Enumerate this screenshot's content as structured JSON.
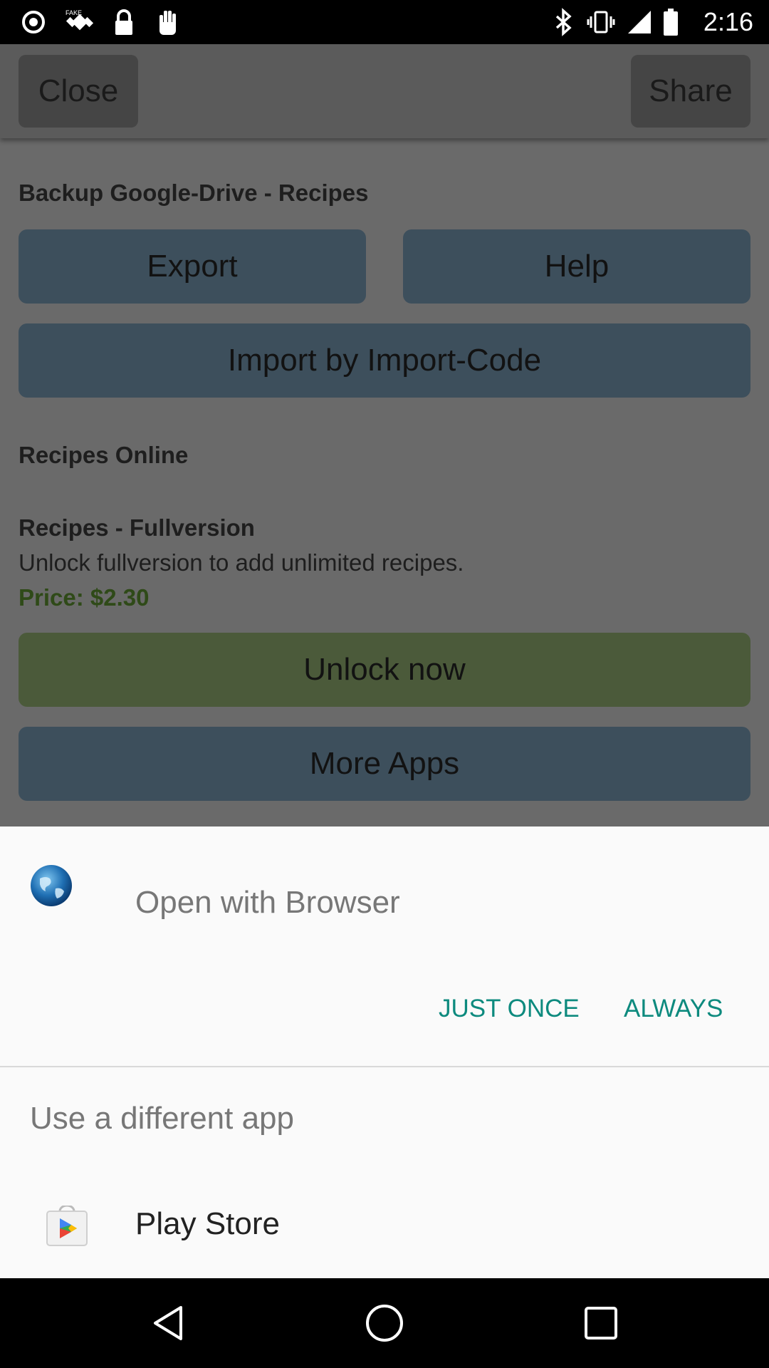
{
  "status_bar": {
    "time": "2:16",
    "icons": [
      "circle-icon",
      "fake-gps-icon",
      "lock-icon",
      "hand-icon",
      "bluetooth-icon",
      "vibrate-icon",
      "signal-icon",
      "battery-icon"
    ]
  },
  "toolbar": {
    "close_label": "Close",
    "share_label": "Share"
  },
  "backup": {
    "title": "Backup Google-Drive - Recipes",
    "export_label": "Export",
    "help_label": "Help",
    "import_label": "Import by Import-Code"
  },
  "online": {
    "title": "Recipes Online"
  },
  "fullversion": {
    "title": "Recipes - Fullversion",
    "description": "Unlock fullversion to add unlimited recipes.",
    "price": "Price: $2.30",
    "unlock_label": "Unlock now"
  },
  "more_apps_label": "More Apps",
  "chooser": {
    "title": "Open with Browser",
    "just_once_label": "JUST ONCE",
    "always_label": "ALWAYS",
    "different_app_label": "Use a different app",
    "play_store_label": "Play Store"
  },
  "colors": {
    "accent": "#0d8a7e"
  }
}
